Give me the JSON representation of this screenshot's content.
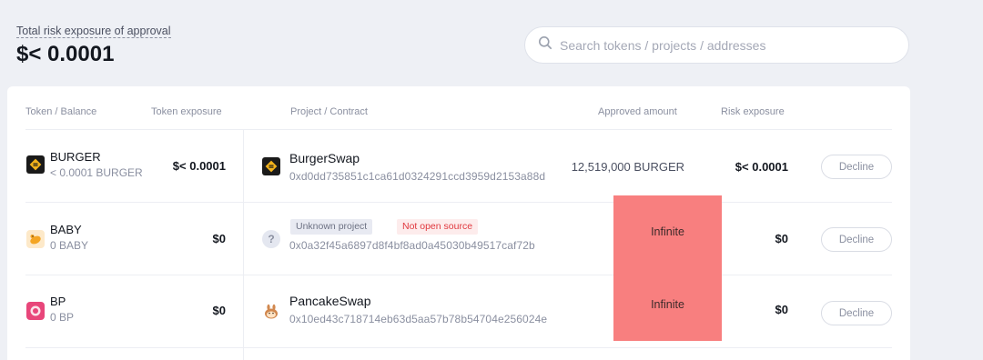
{
  "summary": {
    "label": "Total risk exposure of approval",
    "value": "$< 0.0001"
  },
  "search": {
    "placeholder": "Search tokens / projects / addresses",
    "icon": "search-icon"
  },
  "columns": {
    "token_balance": "Token / Balance",
    "token_exposure": "Token exposure",
    "project_contract": "Project / Contract",
    "approved_amount": "Approved amount",
    "risk_exposure": "Risk exposure"
  },
  "rows": [
    {
      "token_symbol": "BURGER",
      "token_balance": "< 0.0001 BURGER",
      "token_exposure": "$< 0.0001",
      "project_name": "BurgerSwap",
      "contract": "0xd0dd735851c1ca61d0324291ccd3959d2153a88d",
      "approved_amount": "12,519,000 BURGER",
      "risk_exposure": "$< 0.0001",
      "action": "Decline"
    },
    {
      "token_symbol": "BABY",
      "token_balance": "0 BABY",
      "token_exposure": "$0",
      "tag_unknown": "Unknown project",
      "tag_closed": "Not open source",
      "contract": "0x0a32f45a6897d8f4bf8ad0a45030b49517caf72b",
      "approved_amount": "Infinite",
      "risk_exposure": "$0",
      "action": "Decline"
    },
    {
      "token_symbol": "BP",
      "token_balance": "0 BP",
      "token_exposure": "$0",
      "project_name": "PancakeSwap",
      "contract": "0x10ed43c718714eb63d5aa57b78b54704e256024e",
      "approved_amount": "Infinite",
      "risk_exposure": "$0",
      "action": "Decline"
    }
  ],
  "colors": {
    "page_bg": "#eef0f5",
    "card_bg": "#ffffff",
    "infinite_highlight": "#f87f7f",
    "not_open_source": "#e0383e"
  }
}
